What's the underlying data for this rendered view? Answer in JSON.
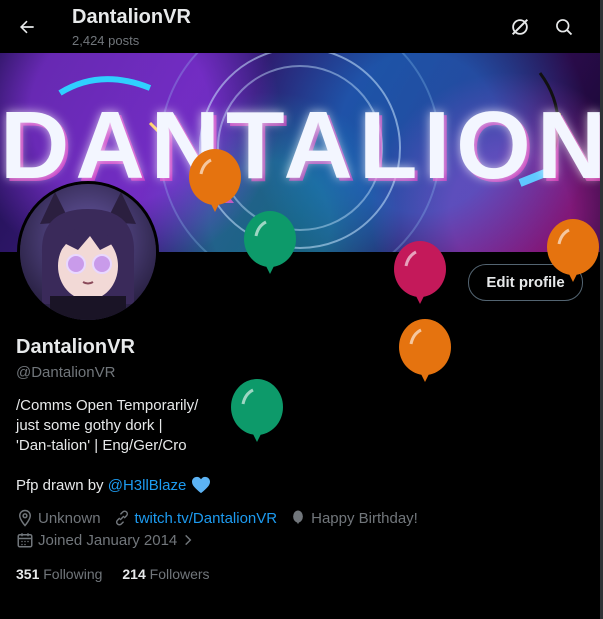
{
  "header": {
    "title": "DantalionVR",
    "post_count": "2,424 posts"
  },
  "banner": {
    "title_text": "DANTALION"
  },
  "profile": {
    "edit_button": "Edit profile",
    "display_name": "DantalionVR",
    "handle": "@DantalionVR",
    "bio_lines": [
      "/Comms Open Temporarily/",
      "just some gothy dork |",
      "'Dan-talion' | Eng/Ger/Cro"
    ],
    "pfp_credit_prefix": "Pfp drawn by",
    "pfp_credit_link": "@H3llBlaze",
    "location": "Unknown",
    "website": "twitch.tv/DantalionVR",
    "birthday": "Happy Birthday!",
    "joined": "Joined January 2014",
    "following_count": "351",
    "following_label": "Following",
    "followers_count": "214",
    "followers_label": "Followers"
  },
  "icons": {
    "back": "arrow-left-icon",
    "grok": "grok-icon",
    "search": "search-icon",
    "location": "location-pin-icon",
    "link": "link-icon",
    "balloon": "balloon-icon",
    "calendar": "calendar-icon",
    "heart": "blue-heart-icon"
  },
  "colors": {
    "background": "#000000",
    "text": "#e7e9ea",
    "muted": "#71767b",
    "accent": "#1d9bf0",
    "balloon_orange": "#e5730f",
    "balloon_green": "#0d9a6a",
    "balloon_magenta": "#c4195a"
  }
}
